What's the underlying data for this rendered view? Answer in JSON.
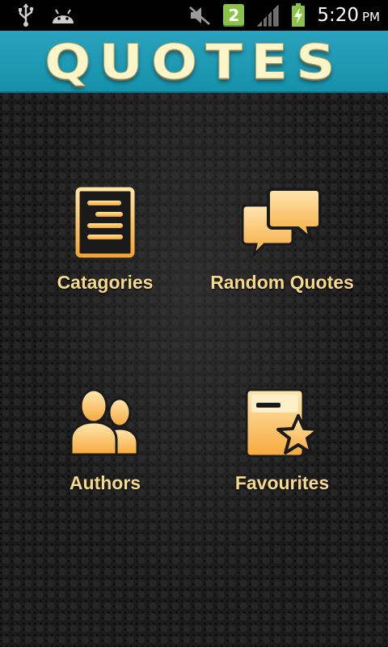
{
  "status_bar": {
    "usb_icon": "usb-icon",
    "android_icon": "android-debug-icon",
    "mute_icon": "muted-speaker-icon",
    "notification_count": "2",
    "signal_icon": "signal-icon",
    "battery_icon": "battery-charging-icon",
    "time": "5:20",
    "ampm": "PM"
  },
  "header": {
    "title": "QUOTES",
    "background_color": "#1e9bb4",
    "title_color": "#fbf5c8"
  },
  "menu": {
    "label_color": "#f7d98a",
    "items": [
      {
        "label": "Catagories",
        "icon": "document-list-icon"
      },
      {
        "label": "Random Quotes",
        "icon": "speech-bubbles-icon"
      },
      {
        "label": "Authors",
        "icon": "users-icon"
      },
      {
        "label": "Favourites",
        "icon": "favourite-star-icon"
      }
    ]
  }
}
